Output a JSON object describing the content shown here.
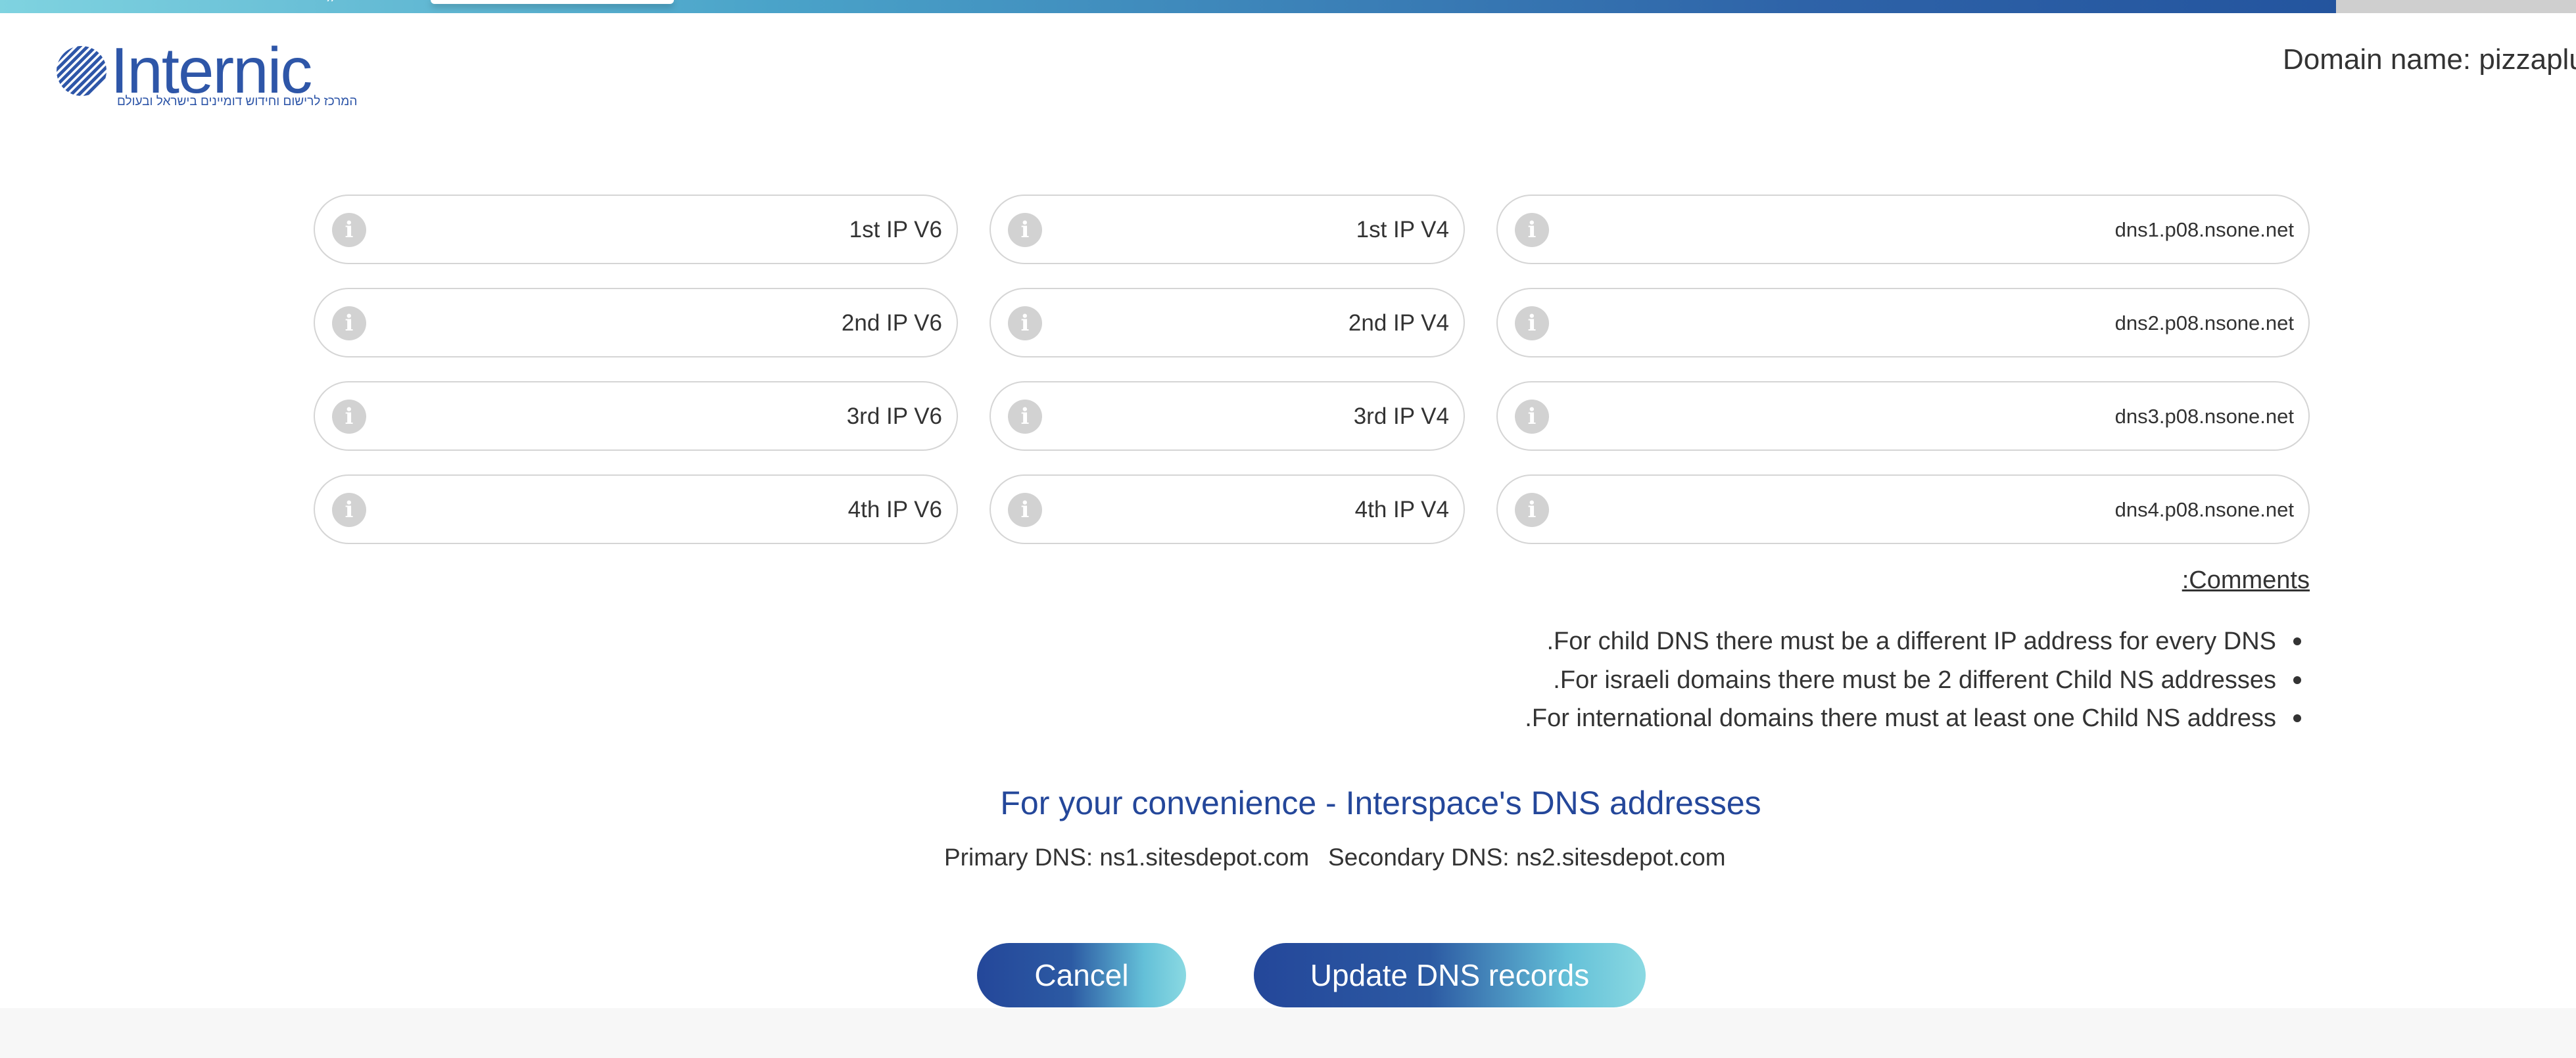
{
  "header": {
    "logo_text": "Internic",
    "logo_tagline": "המרכז לרישום וחידוש דומיינים בישראל ובעולם",
    "domain_label": "Domain name: pizzaplu",
    "brand_color": "#2e56a8"
  },
  "dns_fields": {
    "rows": [
      {
        "ipv6": "1st IP V6",
        "ipv4": "1st IP V4",
        "nameserver": "dns1.p08.nsone.net"
      },
      {
        "ipv6": "2nd IP V6",
        "ipv4": "2nd IP V4",
        "nameserver": "dns2.p08.nsone.net"
      },
      {
        "ipv6": "3rd IP V6",
        "ipv4": "3rd IP V4",
        "nameserver": "dns3.p08.nsone.net"
      },
      {
        "ipv6": "4th IP V6",
        "ipv4": "4th IP V4",
        "nameserver": "dns4.p08.nsone.net"
      }
    ],
    "info_icon": "info-icon"
  },
  "comments": {
    "title": ":Comments",
    "items": [
      ".For child DNS there must be a different IP address for every DNS",
      ".For israeli domains there must be 2 different Child NS addresses",
      ".For international domains there must at least one Child NS address"
    ]
  },
  "convenience": {
    "title": "For your convenience - Interspace's DNS addresses",
    "primary": "Primary DNS: ns1.sitesdepot.com",
    "secondary": "Secondary DNS: ns2.sitesdepot.com",
    "title_color": "#24479a"
  },
  "actions": {
    "cancel_label": "Cancel",
    "update_label": "Update DNS records"
  }
}
